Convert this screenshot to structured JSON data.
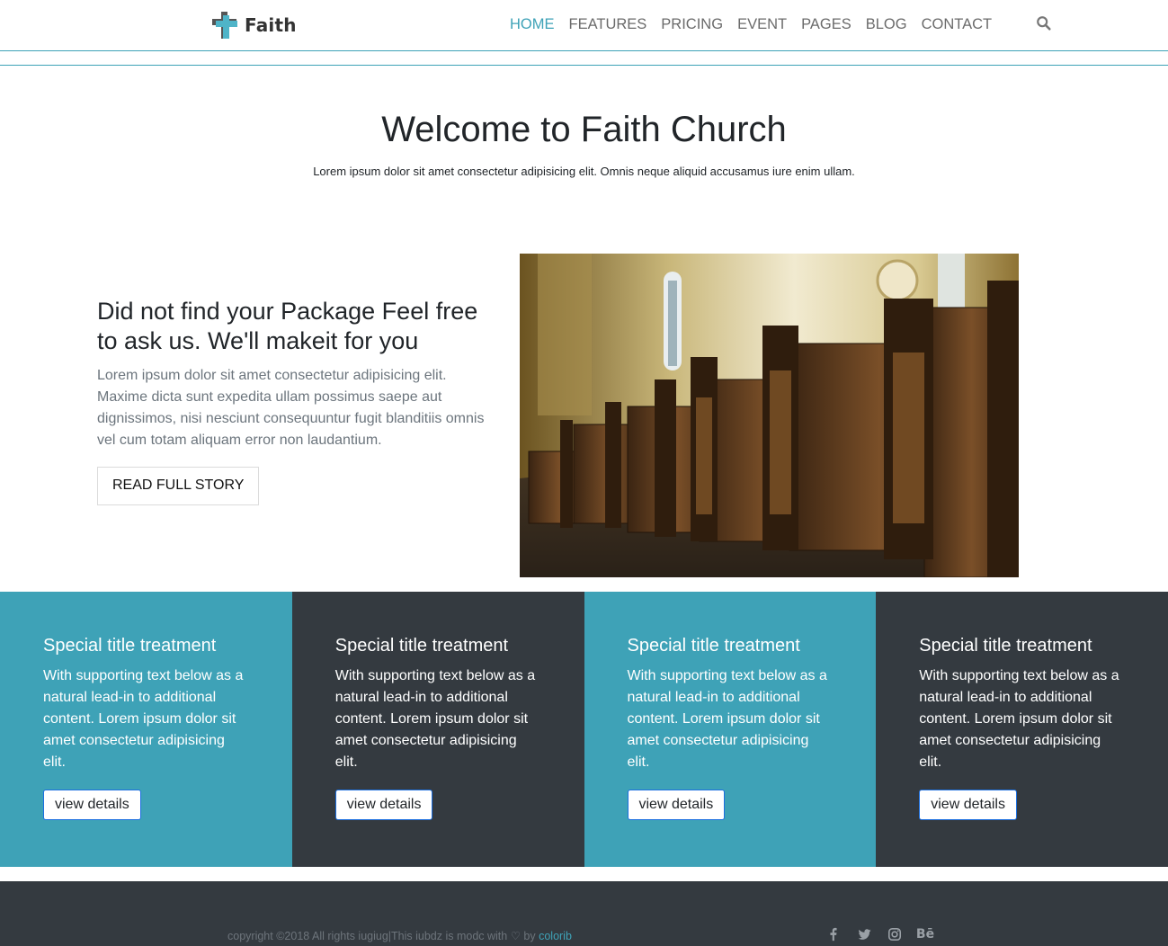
{
  "brand": {
    "name": "Faith"
  },
  "nav": {
    "items": [
      {
        "label": "HOME",
        "active": true
      },
      {
        "label": "FEATURES",
        "active": false
      },
      {
        "label": "PRICING",
        "active": false
      },
      {
        "label": "EVENT",
        "active": false
      },
      {
        "label": "PAGES",
        "active": false
      },
      {
        "label": "BLOG",
        "active": false
      },
      {
        "label": "CONTACT",
        "active": false
      }
    ],
    "search_icon": "search-icon"
  },
  "hero": {
    "title": "Welcome to Faith Church",
    "subtitle": "Lorem ipsum dolor sit amet consectetur adipisicing elit. Omnis neque aliquid accusamus iure enim ullam."
  },
  "story": {
    "heading": "Did not find your Package Feel free to ask us. We'll makeit for you",
    "body": "Lorem ipsum dolor sit amet consectetur adipisicing elit. Maxime dicta sunt expedita ullam possimus saepe aut dignissimos, nisi nesciunt consequuntur fugit blanditiis omnis vel cum totam aliquam error non laudantium.",
    "button": "READ FULL STORY"
  },
  "features": [
    {
      "title": "Special title treatment",
      "text": "With supporting text below as a natural lead-in to additional content. Lorem ipsum dolor sit amet consectetur adipisicing elit.",
      "button": "view details",
      "theme": "teal"
    },
    {
      "title": "Special title treatment",
      "text": "With supporting text below as a natural lead-in to additional content. Lorem ipsum dolor sit amet consectetur adipisicing elit.",
      "button": "view details",
      "theme": "dark"
    },
    {
      "title": "Special title treatment",
      "text": "With supporting text below as a natural lead-in to additional content. Lorem ipsum dolor sit amet consectetur adipisicing elit.",
      "button": "view details",
      "theme": "teal"
    },
    {
      "title": "Special title treatment",
      "text": "With supporting text below as a natural lead-in to additional content. Lorem ipsum dolor sit amet consectetur adipisicing elit.",
      "button": "view details",
      "theme": "dark"
    }
  ],
  "footer": {
    "copyright_prefix": "copyright ",
    "copyright_mid": "2018 All rights iugiug|This iubdz is modc with ",
    "by": " by ",
    "author": "colorib",
    "social": [
      "facebook-icon",
      "twitter-icon",
      "instagram-icon",
      "behance-icon"
    ],
    "behance_label": "Bē"
  },
  "colors": {
    "accent": "#3ea2b7",
    "dark": "#343a40"
  }
}
